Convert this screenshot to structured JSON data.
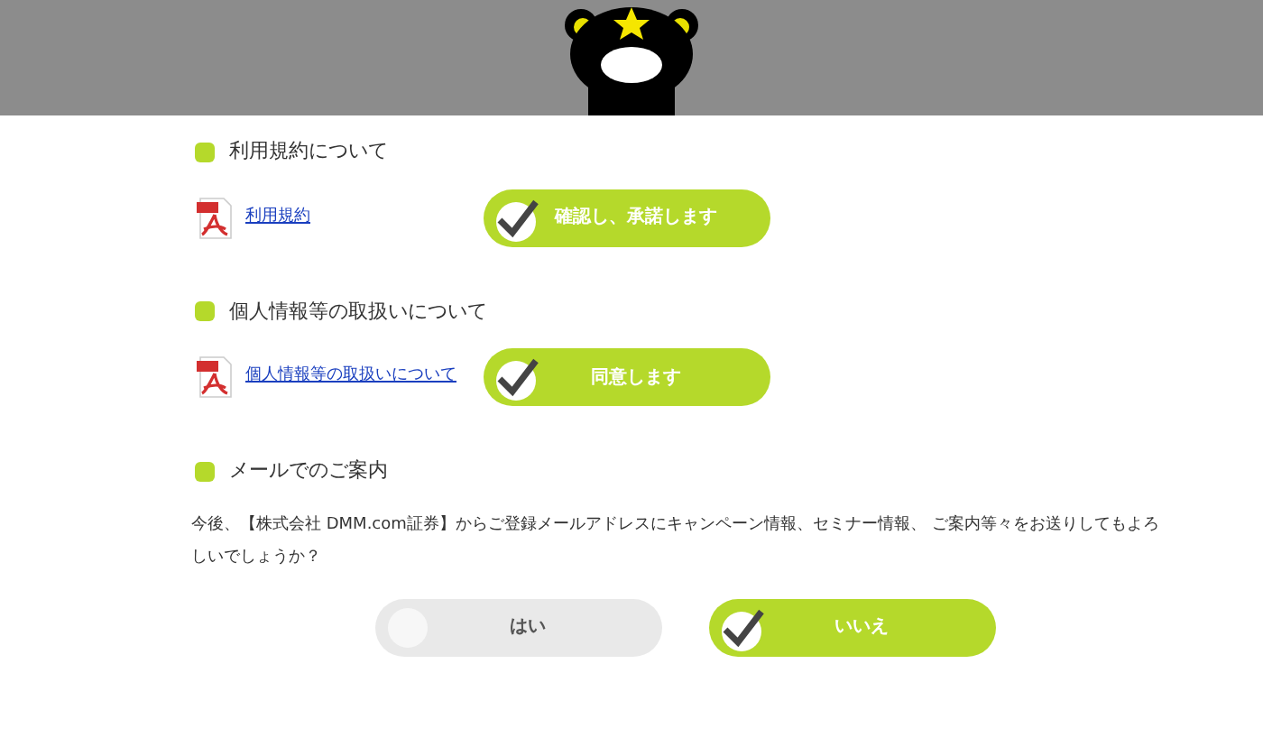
{
  "sections": [
    {
      "heading": "利用規約について",
      "document": "利用規約",
      "buttons": [
        {
          "label": "確認し、承諾します",
          "checked": true
        }
      ]
    },
    {
      "heading": "個人情報等の取扱いについて",
      "document": "個人情報等の取扱いについて",
      "buttons": [
        {
          "label": "同意します",
          "checked": true
        }
      ]
    },
    {
      "heading": "メールでのご案内",
      "question": "今後、【株式会社 DMM.com証券】からご登録メールアドレスにキャンペーン情報、セミナー情報、 ご案内等々をお送りしてもよろしいでしょうか？",
      "buttons": [
        {
          "label": "はい",
          "checked": false
        },
        {
          "label": "いいえ",
          "checked": true
        }
      ]
    }
  ]
}
